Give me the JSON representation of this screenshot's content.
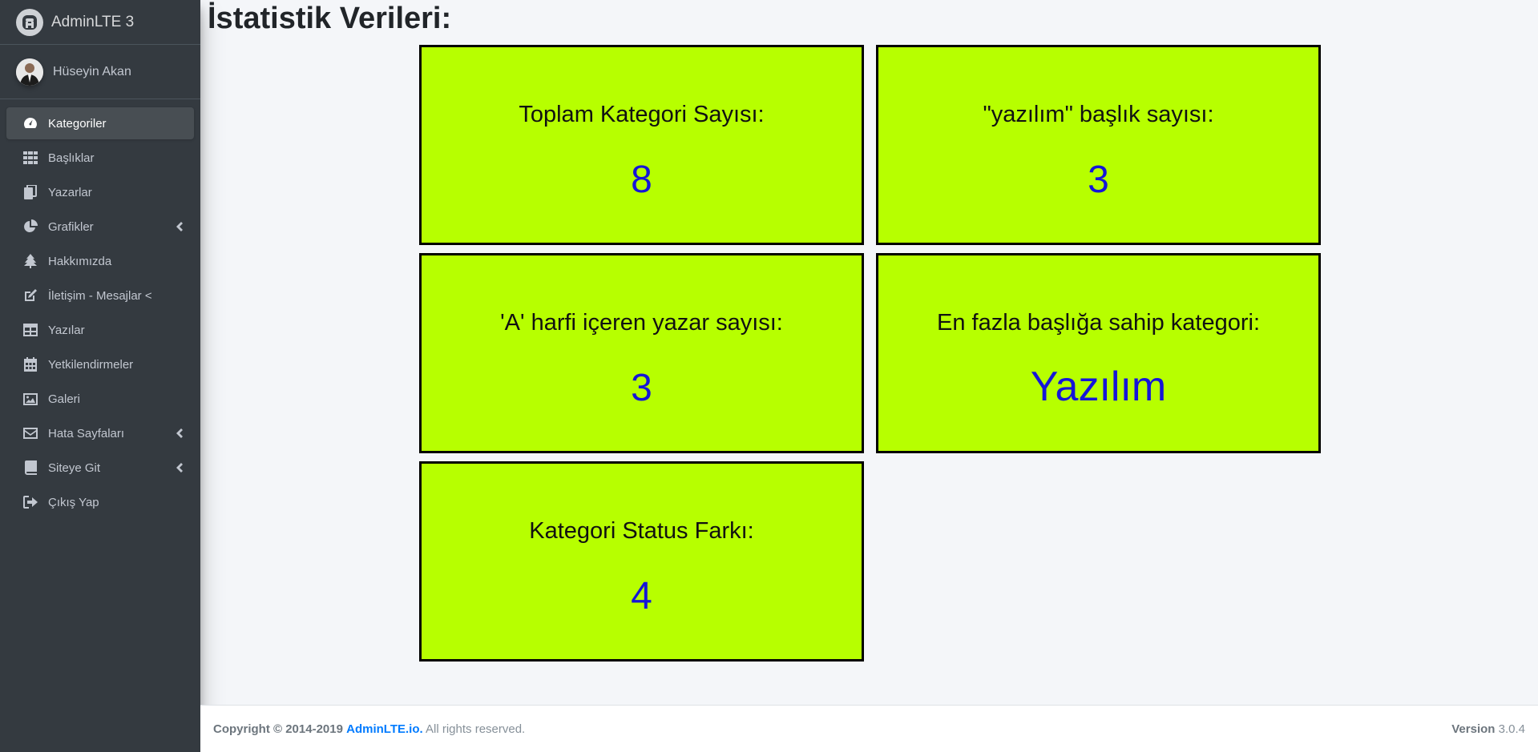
{
  "brand": {
    "title": "AdminLTE 3"
  },
  "user": {
    "name": "Hüseyin Akan"
  },
  "sidebar": {
    "items": [
      {
        "label": "Kategoriler",
        "icon": "tachometer-icon",
        "active": true
      },
      {
        "label": "Başlıklar",
        "icon": "grid-icon"
      },
      {
        "label": "Yazarlar",
        "icon": "copy-icon"
      },
      {
        "label": "Grafikler",
        "icon": "pie-chart-icon",
        "has_children": true
      },
      {
        "label": "Hakkımızda",
        "icon": "tree-icon"
      },
      {
        "label": "İletişim - Mesajlar <",
        "icon": "edit-icon"
      },
      {
        "label": "Yazılar",
        "icon": "table-icon"
      },
      {
        "label": "Yetkilendirmeler",
        "icon": "calendar-icon"
      },
      {
        "label": "Galeri",
        "icon": "image-icon"
      },
      {
        "label": "Hata Sayfaları",
        "icon": "envelope-icon",
        "has_children": true
      },
      {
        "label": "Siteye Git",
        "icon": "book-icon",
        "has_children": true
      },
      {
        "label": "Çıkış Yap",
        "icon": "sign-out-icon"
      }
    ]
  },
  "main": {
    "title": "İstatistik Verileri:",
    "cards": [
      {
        "label": "Toplam Kategori Sayısı:",
        "value": "8"
      },
      {
        "label": "\"yazılım\" başlık sayısı:",
        "value": "3"
      },
      {
        "label": "'A' harfi içeren yazar sayısı:",
        "value": "3"
      },
      {
        "label": "En fazla başlığa sahip kategori:",
        "value": "Yazılım"
      },
      {
        "label": "Kategori Status Farkı:",
        "value": "4"
      }
    ]
  },
  "footer": {
    "copyright": "Copyright © 2014-2019",
    "link": "AdminLTE.io.",
    "rights": "All rights reserved.",
    "version_label": "Version",
    "version": "3.0.4"
  },
  "colors": {
    "sidebar_bg": "#343a40",
    "card_bg": "#b7ff00",
    "value_color": "#1515d8",
    "link": "#007bff"
  }
}
